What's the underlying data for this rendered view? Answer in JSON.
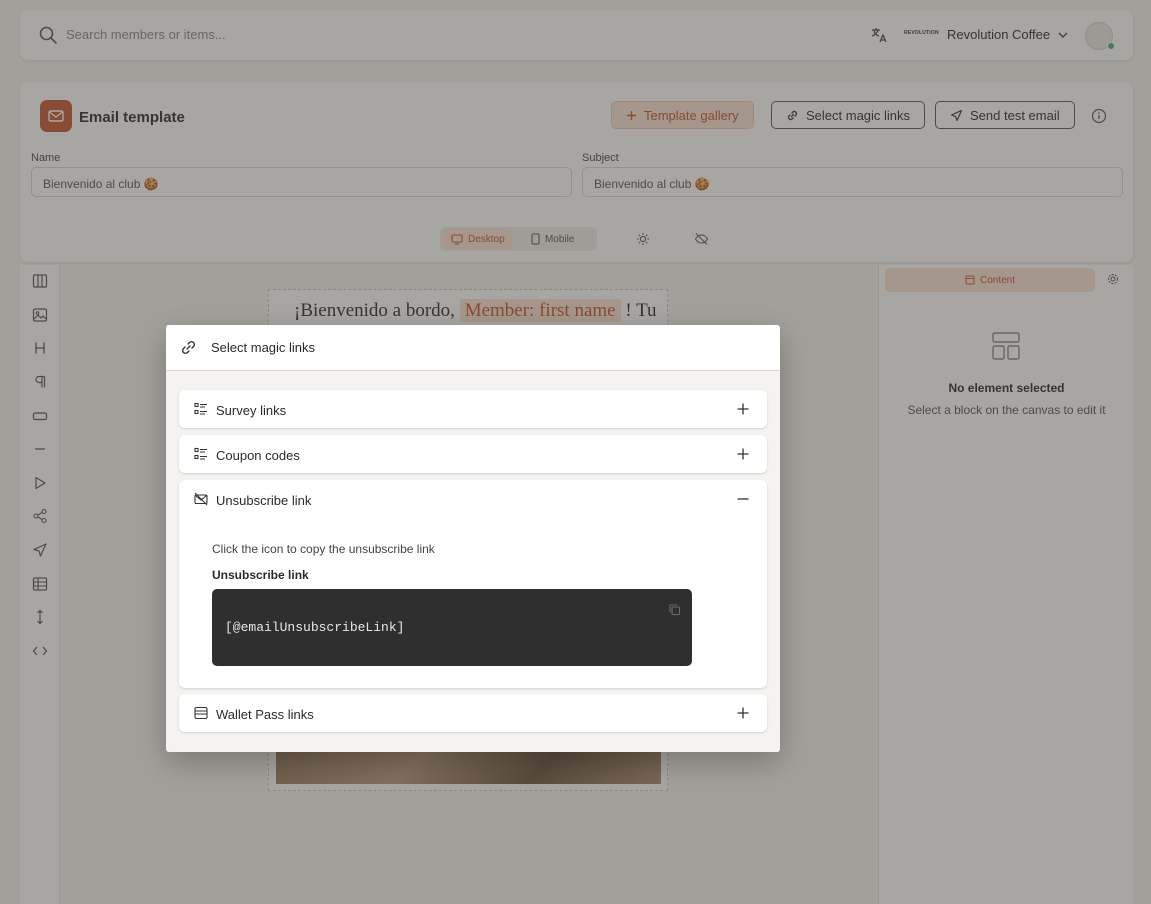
{
  "topbar": {
    "search_placeholder": "Search members or items...",
    "logo_text": "REVOLUTION",
    "org_name": "Revolution Coffee"
  },
  "editor": {
    "title": "Email template",
    "buttons": {
      "template_gallery": "Template gallery",
      "select_magic_links": "Select magic links",
      "send_test_email": "Send test email"
    },
    "name_label": "Name",
    "name_value": "Bienvenido al club 🍪",
    "subject_label": "Subject",
    "subject_value": "Bienvenido al club 🍪",
    "view_modes": [
      "Desktop",
      "Mobile"
    ],
    "active_view_mode": "Desktop"
  },
  "canvas": {
    "heading_prefix": "¡Bienvenido a bordo,",
    "heading_tag": "Member: first name",
    "heading_suffix": "! Tu"
  },
  "right_panel": {
    "tab_label": "Content",
    "empty_title": "No element selected",
    "empty_subtitle": "Select a block on the canvas to edit it"
  },
  "left_tools": [
    "columns-icon",
    "image-icon",
    "heading-icon",
    "paragraph-icon",
    "button-icon",
    "divider-icon",
    "video-icon",
    "social-icon",
    "send-icon",
    "table-icon",
    "spacer-icon",
    "code-icon"
  ],
  "modal": {
    "title": "Select magic links",
    "sections": [
      {
        "label": "Survey links",
        "expanded": false
      },
      {
        "label": "Coupon codes",
        "expanded": false
      },
      {
        "label": "Unsubscribe link",
        "expanded": true
      },
      {
        "label": "Wallet Pass links",
        "expanded": false
      }
    ],
    "unsubscribe": {
      "description": "Click the icon to copy the unsubscribe link",
      "field_label": "Unsubscribe link",
      "code": "[@emailUnsubscribeLink]"
    }
  },
  "colors": {
    "accent": "#c0552e",
    "accent_soft": "#fbe3d6",
    "code_bg": "#2f2f2f",
    "overlay": "#46423a"
  }
}
